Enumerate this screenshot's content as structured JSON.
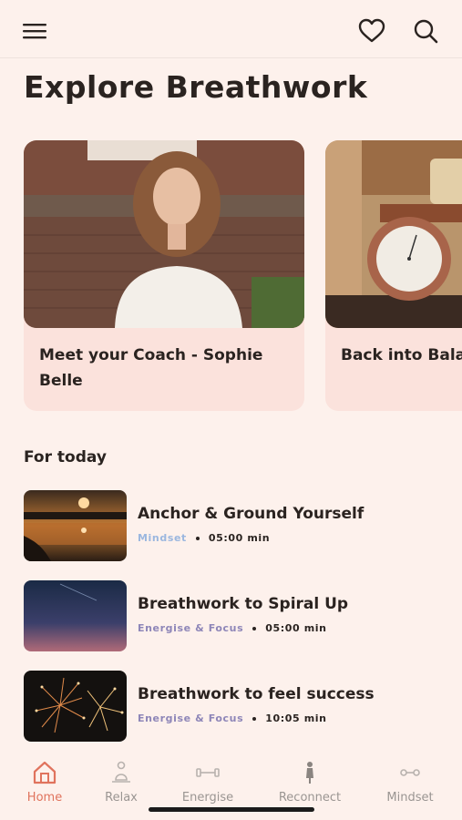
{
  "header": {
    "menu_icon": "menu-icon",
    "favorites_icon": "heart-icon",
    "search_icon": "search-icon"
  },
  "page_title": "Explore Breathwork",
  "featured": [
    {
      "title": "Meet your Coach - Sophie Belle",
      "image": "coach-photo"
    },
    {
      "title": "Back into Balance",
      "image": "scale-photo"
    }
  ],
  "section_title": "For today",
  "sessions": [
    {
      "title": "Anchor & Ground Yourself",
      "tag": "Mindset",
      "duration": "05:00 min"
    },
    {
      "title": "Breathwork to Spiral Up",
      "tag": "Energise & Focus",
      "duration": "05:00 min"
    },
    {
      "title": "Breathwork to feel success",
      "tag": "Energise & Focus",
      "duration": "10:05 min"
    }
  ],
  "bottom_nav": {
    "items": [
      {
        "label": "Home",
        "icon": "home-icon",
        "active": true
      },
      {
        "label": "Relax",
        "icon": "relax-icon",
        "active": false
      },
      {
        "label": "Energise",
        "icon": "dumbbell-icon",
        "active": false
      },
      {
        "label": "Reconnect",
        "icon": "figure-icon",
        "active": false
      },
      {
        "label": "Mindset",
        "icon": "mindset-icon",
        "active": false
      }
    ]
  },
  "colors": {
    "background": "#fdf1ec",
    "card": "#fbe2dc",
    "accent": "#e0735d",
    "tag_purple": "#8e86b8",
    "tag_blue": "#9bb7df"
  }
}
